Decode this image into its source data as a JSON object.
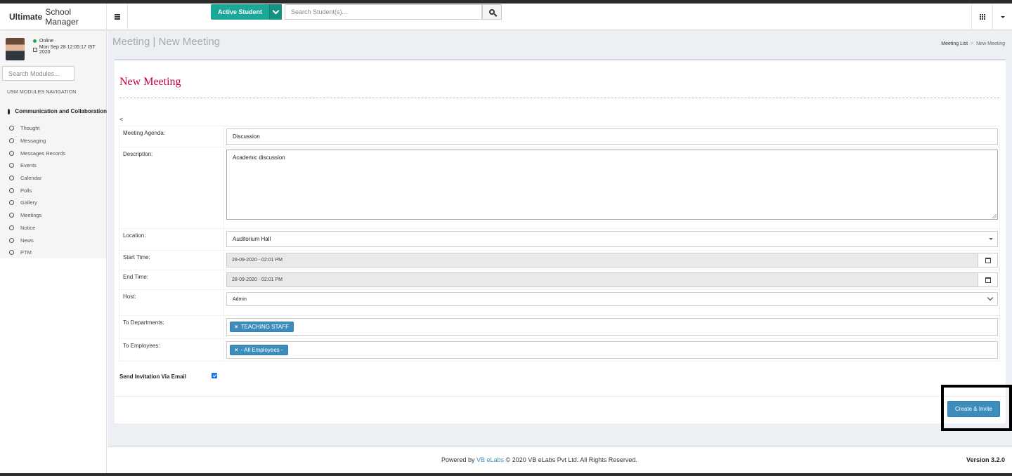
{
  "header": {
    "brand_bold": "Ultimate",
    "brand_rest": "School Manager",
    "active_student_label": "Active Student",
    "search_placeholder": "Search Student(s)..."
  },
  "sidebar": {
    "status": "Online",
    "datetime": "Mon Sep 28 12:05:17 IST 2020",
    "module_search_placeholder": "Search Modules...",
    "nav_header": "USM MODULES NAVIGATION",
    "group_label": "Communication and Collaboration",
    "items": [
      {
        "label": "Thought"
      },
      {
        "label": "Messaging"
      },
      {
        "label": "Messages Records"
      },
      {
        "label": "Events"
      },
      {
        "label": "Calendar"
      },
      {
        "label": "Polls"
      },
      {
        "label": "Gallery"
      },
      {
        "label": "Meetings"
      },
      {
        "label": "Notice"
      },
      {
        "label": "News"
      },
      {
        "label": "PTM"
      }
    ]
  },
  "page": {
    "title": "Meeting | New Meeting",
    "breadcrumb": {
      "parent": "Meeting List",
      "separator": ">",
      "current": "New Meeting"
    }
  },
  "form": {
    "heading": "New Meeting",
    "back_symbol": "<",
    "agenda_label": "Meeting Agenda:",
    "agenda_value": "Discussion",
    "description_label": "Description:",
    "description_value": "Academic discussion",
    "location_label": "Location:",
    "location_value": "Auditorium Hall",
    "start_label": "Start Time:",
    "start_value": "28-09-2020 - 02:01 PM",
    "end_label": "End Time:",
    "end_value": "28-09-2020 - 02:01 PM",
    "host_label": "Host:",
    "host_value": "Admin",
    "departments_label": "To Departments:",
    "departments_tag": "TEACHING STAFF",
    "employees_label": "To Employees:",
    "employees_tag": "- All Employees -",
    "tag_remove": "×",
    "send_invitation_label": "Send Invitation Via Email",
    "submit_label": "Create & Invite"
  },
  "footer": {
    "powered_prefix": "Powered by",
    "company_link": "VB eLabs",
    "rights": "© 2020 VB eLabs Pvt Ltd. All Rights Reserved.",
    "version": "Version 3.2.0"
  },
  "colors": {
    "accent_teal": "#1ba898",
    "primary_blue": "#3c8dbc",
    "heading_red": "#c7003a"
  }
}
